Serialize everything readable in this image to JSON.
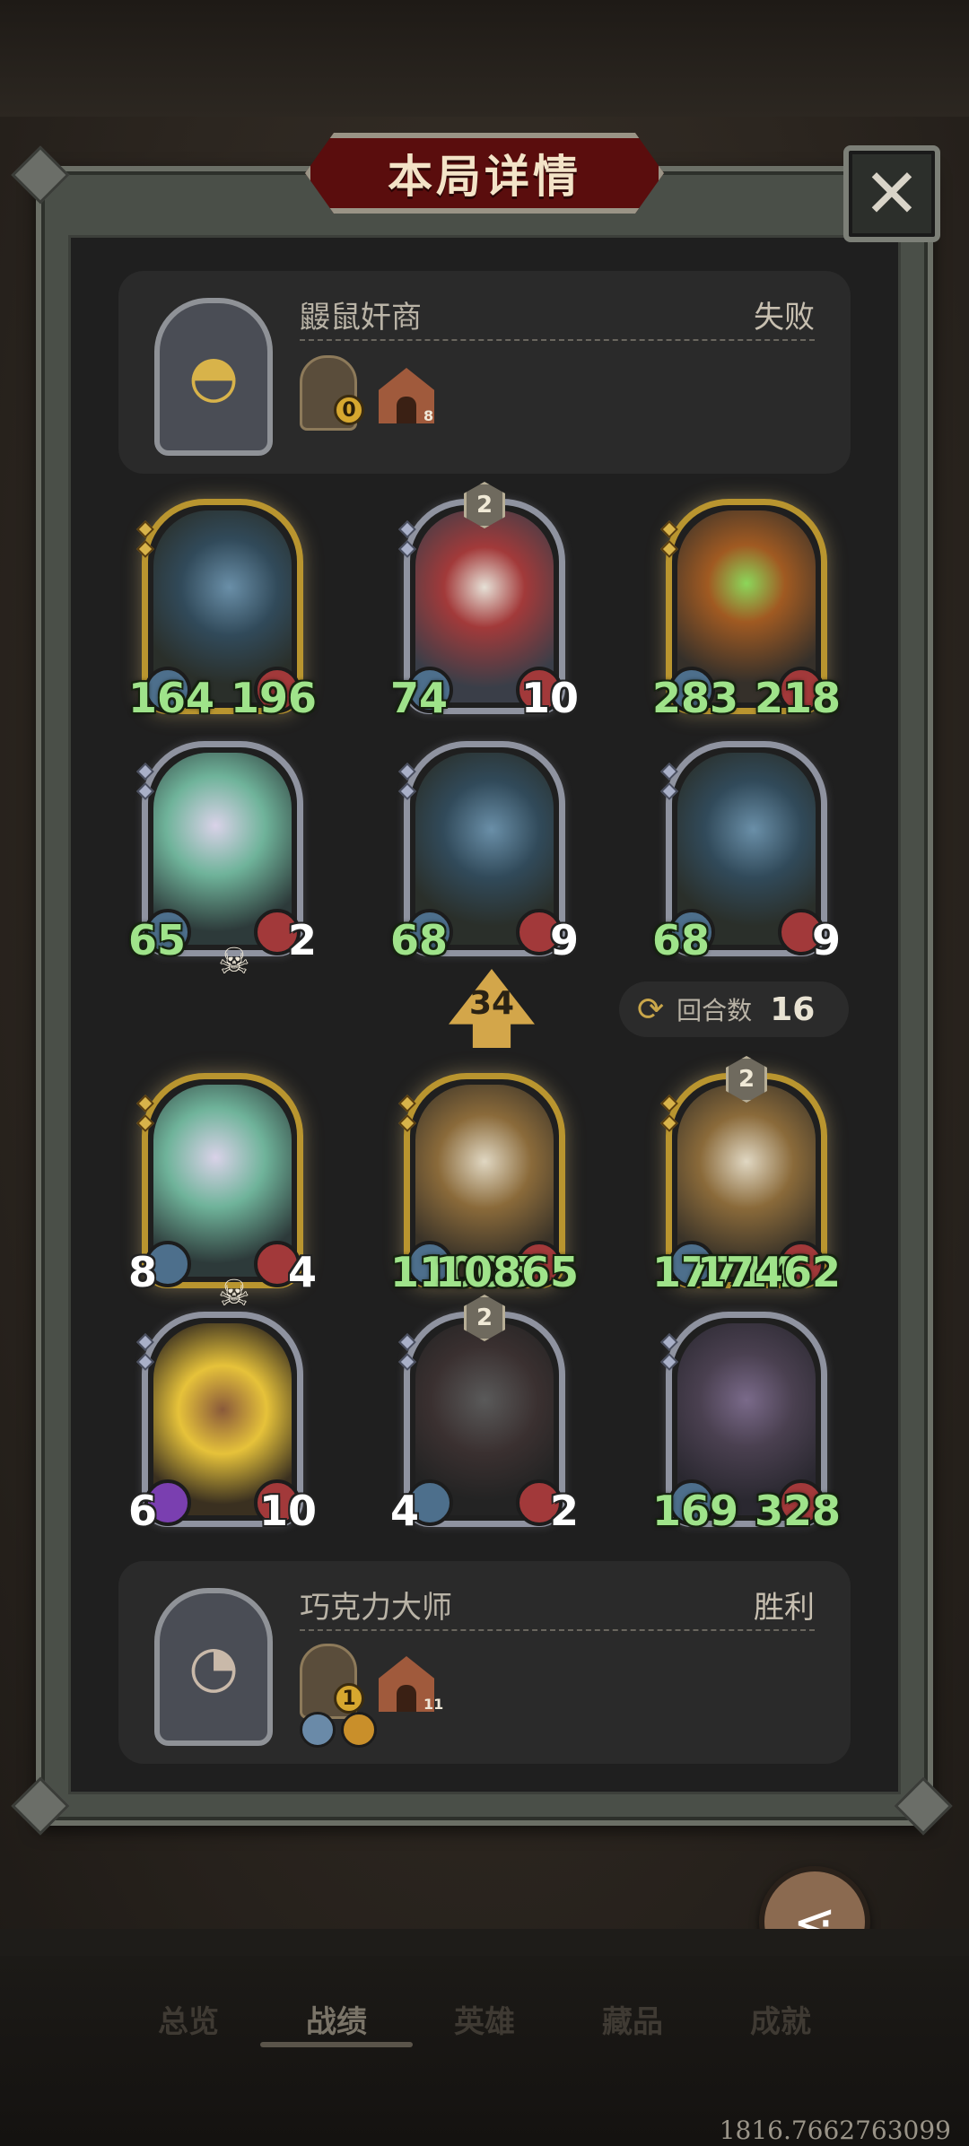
{
  "title": "本局详情",
  "close_icon": "close-icon",
  "opponent": {
    "name": "鼹鼠奸商",
    "result": "失败",
    "item_count": "0",
    "house_level": "8"
  },
  "opponent_board": [
    {
      "art": "dragon",
      "attack": "164",
      "health": "196",
      "frame": "gold",
      "level": ""
    },
    {
      "art": "clown",
      "attack": "74",
      "health": "10",
      "frame": "silver",
      "level": "2"
    },
    {
      "art": "pumpkin",
      "attack": "283",
      "health": "218",
      "frame": "gold",
      "level": ""
    },
    {
      "art": "ghost",
      "attack": "65",
      "health": "2",
      "frame": "silver",
      "level": ""
    },
    {
      "art": "dragon",
      "attack": "68",
      "health": "9",
      "frame": "silver",
      "level": ""
    },
    {
      "art": "dragon",
      "attack": "68",
      "health": "9",
      "frame": "silver",
      "level": ""
    }
  ],
  "arrow_value": "34",
  "rounds": {
    "label": "回合数",
    "value": "16"
  },
  "player_board": [
    {
      "art": "ghost",
      "attack": "8",
      "health": "4",
      "frame": "gold",
      "level": ""
    },
    {
      "art": "knight",
      "attack": "11005",
      "health": "10865",
      "frame": "gold",
      "level": ""
    },
    {
      "art": "knight",
      "attack": "17714",
      "health": "17462",
      "frame": "gold",
      "level": "2"
    },
    {
      "art": "fire",
      "attack": "6",
      "health": "10",
      "frame": "silver",
      "level": ""
    },
    {
      "art": "shield",
      "attack": "4",
      "health": "2",
      "frame": "silver",
      "level": "2"
    },
    {
      "art": "rogue",
      "attack": "169",
      "health": "328",
      "frame": "silver",
      "level": ""
    }
  ],
  "player": {
    "name": "巧克力大师",
    "result": "胜利",
    "item_count": "1",
    "house_level": "11"
  },
  "share_label": "分享",
  "nav": [
    "总览",
    "战绩",
    "英雄",
    "藏品",
    "成就"
  ],
  "coords": "1816.7662763099"
}
